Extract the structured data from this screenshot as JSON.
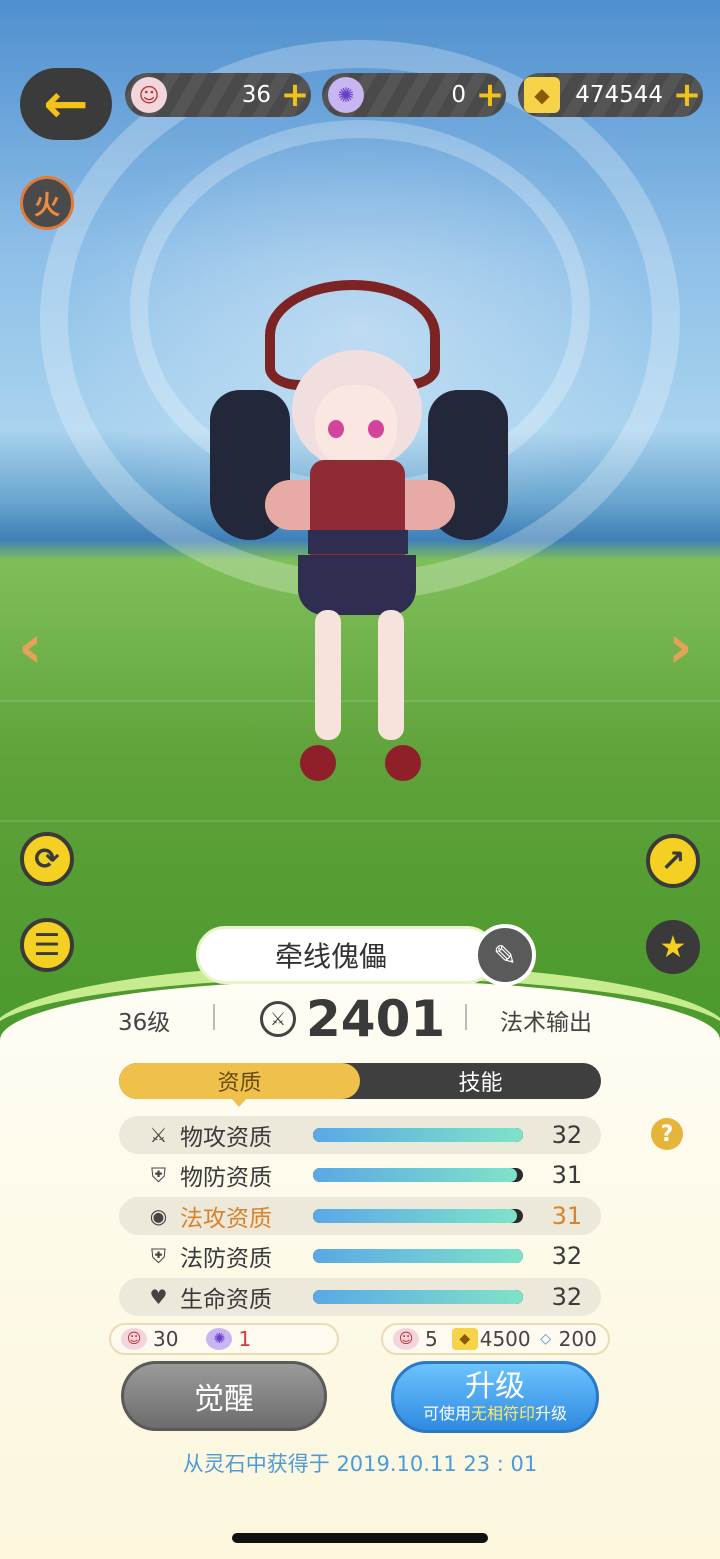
{
  "resources": [
    {
      "icon": "puppet-face-icon",
      "value": "36"
    },
    {
      "icon": "spirit-orb-icon",
      "value": "0"
    },
    {
      "icon": "gold-talisman-icon",
      "value": "474544"
    }
  ],
  "element_badge": "火",
  "character": {
    "name": "牵线傀儡",
    "level": "36级",
    "power": "2401",
    "role": "法术输出"
  },
  "tabs": [
    {
      "label": "资质",
      "active": true
    },
    {
      "label": "技能",
      "active": false
    }
  ],
  "stats": [
    {
      "icon": "sword-icon",
      "label": "物攻资质",
      "value": "32",
      "fill": 1.0,
      "highlight": false,
      "shaded": true
    },
    {
      "icon": "shield-icon",
      "label": "物防资质",
      "value": "31",
      "fill": 0.97,
      "highlight": false,
      "shaded": false
    },
    {
      "icon": "magic-swirl-icon",
      "label": "法攻资质",
      "value": "31",
      "fill": 0.97,
      "highlight": true,
      "shaded": true
    },
    {
      "icon": "shield-icon",
      "label": "法防资质",
      "value": "32",
      "fill": 1.0,
      "highlight": false,
      "shaded": false
    },
    {
      "icon": "heart-icon",
      "label": "生命资质",
      "value": "32",
      "fill": 1.0,
      "highlight": false,
      "shaded": true
    }
  ],
  "costs": {
    "awaken": [
      {
        "icon": "puppet-face-icon",
        "value": "30"
      },
      {
        "icon": "spirit-orb-icon",
        "value": "1"
      }
    ],
    "upgrade": [
      {
        "icon": "puppet-face-icon",
        "value": "5"
      },
      {
        "icon": "gold-talisman-icon",
        "value": "4500"
      },
      {
        "icon": "diamond-icon",
        "value": "200"
      }
    ]
  },
  "buttons": {
    "awaken": "觉醒",
    "upgrade": "升级",
    "upgrade_sub_pre": "可使用",
    "upgrade_sub_hl": "无相符印",
    "upgrade_sub_post": "升级"
  },
  "source_text": "从灵石中获得于 2019.10.11   23 : 01",
  "colors": {
    "accent_yellow": "#f2c316",
    "highlight_orange": "#d9822b",
    "upgrade_blue": "#2f8ae0",
    "source_blue": "#4d9bd8"
  }
}
